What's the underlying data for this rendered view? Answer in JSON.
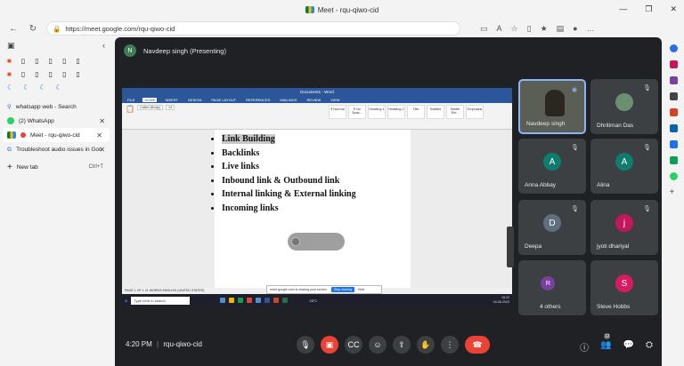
{
  "window": {
    "title": "Meet - rqu-qiwo-cid",
    "min": "—",
    "restore": "❐",
    "close": "✕"
  },
  "address": {
    "url": "https://meet.google.com/rqu-qiwo-cid"
  },
  "tabs": [
    {
      "label": "whatsapp web - Search",
      "color": "#2b6de8"
    },
    {
      "label": "(2) WhatsApp",
      "color": "#25d366"
    },
    {
      "label": "Meet - rqu-qiwo-cid",
      "color": "#ea4335",
      "active": true
    },
    {
      "label": "Troubleshoot audio issues in Goo",
      "color": "#4285f4"
    }
  ],
  "new_tab": {
    "label": "New tab",
    "shortcut": "Ctrl+T"
  },
  "meet": {
    "presenter_initial": "N",
    "presenter_label": "Navdeep singh (Presenting)",
    "time": "4:20 PM",
    "separator": "|",
    "code": "rqu-qiwo-cid",
    "participant_count": "12"
  },
  "word": {
    "title": "Document1 - Word",
    "tabs": [
      "FILE",
      "HOME",
      "INSERT",
      "DESIGN",
      "PAGE LAYOUT",
      "REFERENCES",
      "MAILINGS",
      "REVIEW",
      "VIEW"
    ],
    "styles": [
      "¶ Normal",
      "¶ No Spac...",
      "Heading 1",
      "Heading 2",
      "Title",
      "Subtitle",
      "Subtle Em...",
      "Emphasis"
    ],
    "font": "Calibri (Body)",
    "font_size": "14",
    "bullets": [
      "Link Building",
      "Backlinks",
      "Live links",
      "Inbound link & Outbound link",
      "Internal linking & External linking",
      "Incoming links"
    ],
    "status": "PAGE 1 OF 1    21 WORDS    ENGLISH (UNITED STATES)"
  },
  "sharebar": {
    "text": "meet.google.com is sharing your screen.",
    "stop": "Stop sharing",
    "hide": "Hide"
  },
  "taskbar": {
    "search": "Type here to search",
    "temp": "28°C",
    "time": "16:20",
    "date": "04-08-2023"
  },
  "participants": [
    {
      "name": "Navdeep singh",
      "initial": "",
      "color": "#5a5e55"
    },
    {
      "name": "Dhritiman Das",
      "initial": "",
      "color": "#6b8f71"
    },
    {
      "name": "Anna Abbay",
      "initial": "A",
      "color": "#0f7c6e"
    },
    {
      "name": "Alina",
      "initial": "A",
      "color": "#0f7c6e"
    },
    {
      "name": "Deepa",
      "initial": "D",
      "color": "#5f6f7d"
    },
    {
      "name": "jyoti dhariyal",
      "initial": "j",
      "color": "#c2185b"
    },
    {
      "name": "4 others",
      "initial": "R",
      "color": "#7b3fa0"
    },
    {
      "name": "Steve Hobbs",
      "initial": "S",
      "color": "#d81b60"
    }
  ]
}
